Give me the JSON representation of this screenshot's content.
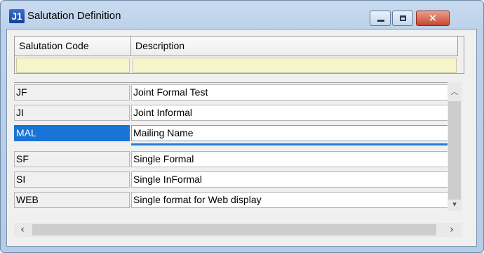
{
  "window": {
    "app_icon_text": "J1",
    "title": "Salutation Definition",
    "minimize_glyph": "",
    "restore_glyph": "",
    "close_glyph": "✕"
  },
  "columns": {
    "code": "Salutation Code",
    "description": "Description"
  },
  "filters": {
    "code": "",
    "description": ""
  },
  "rows": [
    {
      "code": "JF",
      "description": "Joint Formal Test",
      "selected": false
    },
    {
      "code": "JI",
      "description": "Joint Informal",
      "selected": false
    },
    {
      "code": "MAL",
      "description": "Mailing Name",
      "selected": true
    },
    {
      "code": "SF",
      "description": "Single Formal",
      "selected": false
    },
    {
      "code": "SI",
      "description": "Single InFormal",
      "selected": false
    },
    {
      "code": "WEB",
      "description": "Single format for Web display",
      "selected": false
    }
  ],
  "scroll": {
    "up_icon": "chevron-up-icon",
    "down_icon": "chevron-down-icon",
    "left_icon": "chevron-left-icon",
    "right_icon": "chevron-right-icon",
    "up_glyph": "︿",
    "down_glyph": "▾",
    "left_glyph": "‹",
    "right_glyph": "›"
  },
  "colors": {
    "selection": "#1a73d6",
    "filter_row": "#f6f5c9",
    "close_button": "#c9472e"
  }
}
